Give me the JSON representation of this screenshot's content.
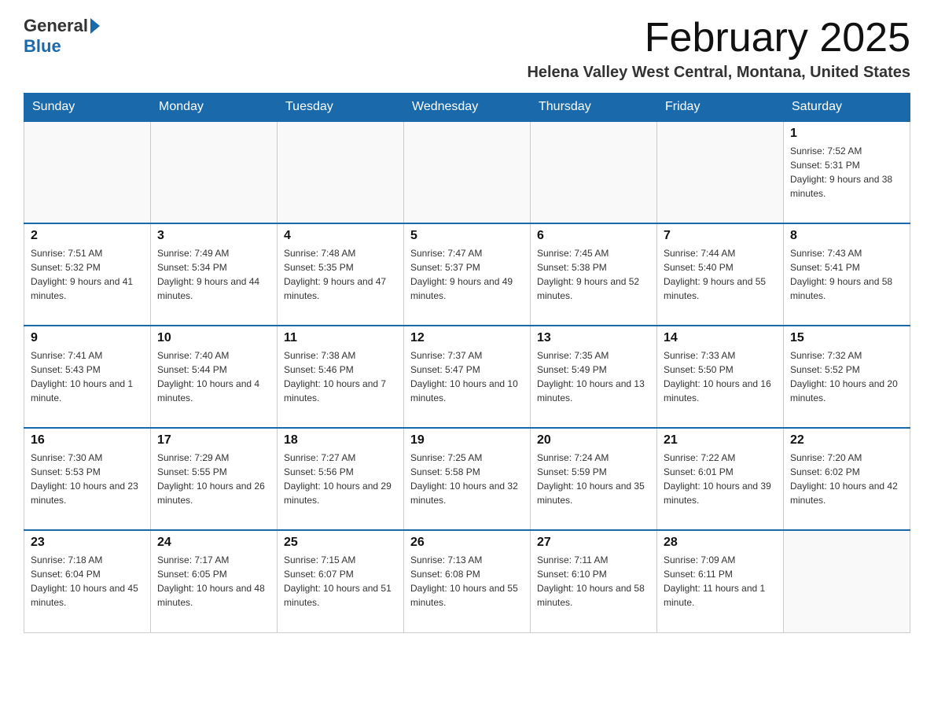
{
  "logo": {
    "text_general": "General",
    "text_blue": "Blue"
  },
  "header": {
    "title": "February 2025",
    "subtitle": "Helena Valley West Central, Montana, United States"
  },
  "days_of_week": [
    "Sunday",
    "Monday",
    "Tuesday",
    "Wednesday",
    "Thursday",
    "Friday",
    "Saturday"
  ],
  "weeks": [
    [
      {
        "day": "",
        "empty": true
      },
      {
        "day": "",
        "empty": true
      },
      {
        "day": "",
        "empty": true
      },
      {
        "day": "",
        "empty": true
      },
      {
        "day": "",
        "empty": true
      },
      {
        "day": "",
        "empty": true
      },
      {
        "day": "1",
        "sunrise": "7:52 AM",
        "sunset": "5:31 PM",
        "daylight": "9 hours and 38 minutes."
      }
    ],
    [
      {
        "day": "2",
        "sunrise": "7:51 AM",
        "sunset": "5:32 PM",
        "daylight": "9 hours and 41 minutes."
      },
      {
        "day": "3",
        "sunrise": "7:49 AM",
        "sunset": "5:34 PM",
        "daylight": "9 hours and 44 minutes."
      },
      {
        "day": "4",
        "sunrise": "7:48 AM",
        "sunset": "5:35 PM",
        "daylight": "9 hours and 47 minutes."
      },
      {
        "day": "5",
        "sunrise": "7:47 AM",
        "sunset": "5:37 PM",
        "daylight": "9 hours and 49 minutes."
      },
      {
        "day": "6",
        "sunrise": "7:45 AM",
        "sunset": "5:38 PM",
        "daylight": "9 hours and 52 minutes."
      },
      {
        "day": "7",
        "sunrise": "7:44 AM",
        "sunset": "5:40 PM",
        "daylight": "9 hours and 55 minutes."
      },
      {
        "day": "8",
        "sunrise": "7:43 AM",
        "sunset": "5:41 PM",
        "daylight": "9 hours and 58 minutes."
      }
    ],
    [
      {
        "day": "9",
        "sunrise": "7:41 AM",
        "sunset": "5:43 PM",
        "daylight": "10 hours and 1 minute."
      },
      {
        "day": "10",
        "sunrise": "7:40 AM",
        "sunset": "5:44 PM",
        "daylight": "10 hours and 4 minutes."
      },
      {
        "day": "11",
        "sunrise": "7:38 AM",
        "sunset": "5:46 PM",
        "daylight": "10 hours and 7 minutes."
      },
      {
        "day": "12",
        "sunrise": "7:37 AM",
        "sunset": "5:47 PM",
        "daylight": "10 hours and 10 minutes."
      },
      {
        "day": "13",
        "sunrise": "7:35 AM",
        "sunset": "5:49 PM",
        "daylight": "10 hours and 13 minutes."
      },
      {
        "day": "14",
        "sunrise": "7:33 AM",
        "sunset": "5:50 PM",
        "daylight": "10 hours and 16 minutes."
      },
      {
        "day": "15",
        "sunrise": "7:32 AM",
        "sunset": "5:52 PM",
        "daylight": "10 hours and 20 minutes."
      }
    ],
    [
      {
        "day": "16",
        "sunrise": "7:30 AM",
        "sunset": "5:53 PM",
        "daylight": "10 hours and 23 minutes."
      },
      {
        "day": "17",
        "sunrise": "7:29 AM",
        "sunset": "5:55 PM",
        "daylight": "10 hours and 26 minutes."
      },
      {
        "day": "18",
        "sunrise": "7:27 AM",
        "sunset": "5:56 PM",
        "daylight": "10 hours and 29 minutes."
      },
      {
        "day": "19",
        "sunrise": "7:25 AM",
        "sunset": "5:58 PM",
        "daylight": "10 hours and 32 minutes."
      },
      {
        "day": "20",
        "sunrise": "7:24 AM",
        "sunset": "5:59 PM",
        "daylight": "10 hours and 35 minutes."
      },
      {
        "day": "21",
        "sunrise": "7:22 AM",
        "sunset": "6:01 PM",
        "daylight": "10 hours and 39 minutes."
      },
      {
        "day": "22",
        "sunrise": "7:20 AM",
        "sunset": "6:02 PM",
        "daylight": "10 hours and 42 minutes."
      }
    ],
    [
      {
        "day": "23",
        "sunrise": "7:18 AM",
        "sunset": "6:04 PM",
        "daylight": "10 hours and 45 minutes."
      },
      {
        "day": "24",
        "sunrise": "7:17 AM",
        "sunset": "6:05 PM",
        "daylight": "10 hours and 48 minutes."
      },
      {
        "day": "25",
        "sunrise": "7:15 AM",
        "sunset": "6:07 PM",
        "daylight": "10 hours and 51 minutes."
      },
      {
        "day": "26",
        "sunrise": "7:13 AM",
        "sunset": "6:08 PM",
        "daylight": "10 hours and 55 minutes."
      },
      {
        "day": "27",
        "sunrise": "7:11 AM",
        "sunset": "6:10 PM",
        "daylight": "10 hours and 58 minutes."
      },
      {
        "day": "28",
        "sunrise": "7:09 AM",
        "sunset": "6:11 PM",
        "daylight": "11 hours and 1 minute."
      },
      {
        "day": "",
        "empty": true
      }
    ]
  ]
}
